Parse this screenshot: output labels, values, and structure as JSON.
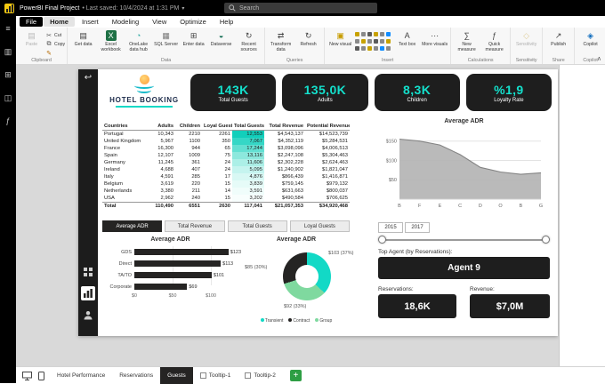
{
  "app": {
    "title": "PowerBI Final Project",
    "saved": "• Last saved: 10/4/2024 at 1:31 PM",
    "search_placeholder": "Search"
  },
  "menu": {
    "tabs": [
      "File",
      "Home",
      "Insert",
      "Modeling",
      "View",
      "Optimize",
      "Help"
    ],
    "active_index": 1
  },
  "ribbon": {
    "groups": [
      {
        "label": "Clipboard",
        "type": "clipboard",
        "items": [
          {
            "t": "Paste",
            "icon": "paste-icon",
            "disabled": true
          },
          {
            "t": "Cut",
            "icon": "cut-icon"
          },
          {
            "t": "Copy",
            "icon": "copy-icon"
          },
          {
            "t": "Format painter",
            "icon": "format-painter-icon"
          }
        ]
      },
      {
        "label": "Data",
        "items": [
          {
            "t": "Get data",
            "icon": "database-icon"
          },
          {
            "t": "Excel workbook",
            "icon": "excel-icon"
          },
          {
            "t": "OneLake data hub",
            "icon": "onelake-icon"
          },
          {
            "t": "SQL Server",
            "icon": "sql-server-icon"
          },
          {
            "t": "Enter data",
            "icon": "enter-data-icon"
          },
          {
            "t": "Dataverse",
            "icon": "dataverse-icon"
          },
          {
            "t": "Recent sources",
            "icon": "recent-sources-icon"
          }
        ]
      },
      {
        "label": "Queries",
        "items": [
          {
            "t": "Transform data",
            "icon": "transform-data-icon"
          },
          {
            "t": "Refresh",
            "icon": "refresh-icon"
          }
        ]
      },
      {
        "label": "Insert",
        "type": "insert",
        "items": [
          {
            "t": "New visual",
            "icon": "new-visual-icon"
          },
          {
            "t": "Text box",
            "icon": "text-box-icon"
          },
          {
            "t": "More visuals",
            "icon": "more-visuals-icon"
          }
        ]
      },
      {
        "label": "Calculations",
        "items": [
          {
            "t": "New measure",
            "icon": "new-measure-icon"
          },
          {
            "t": "Quick measure",
            "icon": "quick-measure-icon"
          }
        ]
      },
      {
        "label": "Sensitivity",
        "items": [
          {
            "t": "Sensitivity",
            "icon": "sensitivity-icon",
            "disabled": true
          }
        ]
      },
      {
        "label": "Share",
        "items": [
          {
            "t": "Publish",
            "icon": "publish-icon"
          }
        ]
      },
      {
        "label": "Copilot",
        "items": [
          {
            "t": "Copilot",
            "icon": "copilot-icon"
          }
        ]
      }
    ]
  },
  "rail": {
    "icons": [
      {
        "name": "menu-icon",
        "glyph": "≡"
      },
      {
        "name": "report-view-icon",
        "glyph": "▥"
      },
      {
        "name": "data-view-icon",
        "glyph": "⊞"
      },
      {
        "name": "model-view-icon",
        "glyph": "◫"
      },
      {
        "name": "dax-query-view-icon",
        "glyph": "ƒ"
      }
    ]
  },
  "logo": {
    "title": "HOTEL BOOKING"
  },
  "kpis": [
    {
      "value": "143K",
      "label": "Total Guests"
    },
    {
      "value": "135,0K",
      "label": "Adults"
    },
    {
      "value": "8,3K",
      "label": "Children"
    },
    {
      "value": "%1,9",
      "label": "Loyalty Rate"
    }
  ],
  "table": {
    "columns": [
      "Countries",
      "Adults",
      "Children",
      "Loyal Guests",
      "Total Guests",
      "Total Revenue",
      "Potential Revenue"
    ],
    "rows": [
      {
        "c": [
          "Portugal",
          "10,343",
          "2210",
          "2261",
          "12,553",
          "$4,543,137",
          "$14,523,739"
        ],
        "hl": "#12CFBB"
      },
      {
        "c": [
          "United Kingdom",
          "5,967",
          "1100",
          "350",
          "7,067",
          "$4,352,119",
          "$5,284,531"
        ],
        "hl": "#35D7C6"
      },
      {
        "c": [
          "France",
          "16,300",
          "944",
          "65",
          "17,244",
          "$3,098,096",
          "$4,006,513"
        ],
        "hl": "#63E0D2"
      },
      {
        "c": [
          "Spain",
          "12,107",
          "1009",
          "75",
          "13,116",
          "$2,247,108",
          "$5,304,463"
        ],
        "hl": "#8CE8DD"
      },
      {
        "c": [
          "Germany",
          "11,245",
          "361",
          "24",
          "11,606",
          "$2,302,228",
          "$2,624,463"
        ],
        "hl": "#ACEFE7"
      },
      {
        "c": [
          "Ireland",
          "4,688",
          "407",
          "24",
          "5,095",
          "$1,240,902",
          "$1,821,047"
        ],
        "hl": "#C5F4EF"
      },
      {
        "c": [
          "Italy",
          "4,591",
          "285",
          "17",
          "4,876",
          "$866,439",
          "$1,416,871"
        ],
        "hl": "#D8F8F4"
      },
      {
        "c": [
          "Belgium",
          "3,619",
          "220",
          "15",
          "3,839",
          "$759,145",
          "$979,132"
        ],
        "hl": "#E6FBF8"
      },
      {
        "c": [
          "Netherlands",
          "3,380",
          "211",
          "14",
          "3,591",
          "$631,663",
          "$800,037"
        ],
        "hl": "#F0FDFB"
      },
      {
        "c": [
          "USA",
          "2,962",
          "240",
          "15",
          "3,202",
          "$490,584",
          "$706,625"
        ],
        "hl": "#F8FEFD"
      }
    ],
    "total": [
      "Total",
      "110,490",
      "6551",
      "2630",
      "117,041",
      "$21,057,353",
      "$34,920,468"
    ]
  },
  "toggles": [
    {
      "label": "Average ADR",
      "active": true
    },
    {
      "label": "Total Revenue",
      "active": false
    },
    {
      "label": "Total Guests",
      "active": false
    },
    {
      "label": "Loyal Guests",
      "active": false
    }
  ],
  "charts": {
    "adr_trend": {
      "type": "area",
      "title": "Average ADR",
      "x": [
        "B",
        "F",
        "E",
        "C",
        "D",
        "O",
        "B",
        "G"
      ],
      "values": [
        155,
        150,
        140,
        115,
        82,
        70,
        64,
        68
      ],
      "ymax": 170,
      "yticks": [
        {
          "v": 150,
          "t": "$150"
        },
        {
          "v": 100,
          "t": "$100"
        },
        {
          "v": 50,
          "t": "$50"
        }
      ]
    },
    "adr_by_channel": {
      "type": "bar",
      "title": "Average ADR",
      "categories": [
        "GDS",
        "Direct",
        "TA/TO",
        "Corporate"
      ],
      "values": [
        123,
        113,
        101,
        69
      ],
      "labels": [
        "$123",
        "$113",
        "$101",
        "$69"
      ],
      "xticks": [
        {
          "v": 0,
          "t": "$0"
        },
        {
          "v": 50,
          "t": "$50"
        },
        {
          "v": 100,
          "t": "$100"
        }
      ]
    },
    "adr_by_segment": {
      "type": "donut",
      "title": "Average ADR",
      "segments": [
        {
          "name": "Transient",
          "pct": 37,
          "label": "$103 (37%)",
          "color": "#12D9C6"
        },
        {
          "name": "Contract",
          "pct": 30,
          "label": "$85 (30%)",
          "color": "#252423"
        },
        {
          "name": "Group",
          "pct": 33,
          "label": "$92 (33%)",
          "color": "#7FD99F"
        }
      ]
    }
  },
  "slider": {
    "start": "2015",
    "end": "2017"
  },
  "agent": {
    "label": "Top Agent (by Reservations):",
    "value": "Agent 9"
  },
  "stats": {
    "reservations_label": "Reservations:",
    "reservations_value": "18,6K",
    "revenue_label": "Revenue:",
    "revenue_value": "$7,0M"
  },
  "pages": {
    "tabs": [
      {
        "label": "Hotel Performance",
        "active": false,
        "icon": false
      },
      {
        "label": "Reservations",
        "active": false,
        "icon": false
      },
      {
        "label": "Guests",
        "active": true,
        "icon": false
      },
      {
        "label": "Tooltip-1",
        "active": false,
        "icon": true
      },
      {
        "label": "Tooltip-2",
        "active": false,
        "icon": true
      }
    ],
    "new_page_label": "+"
  },
  "colors": {
    "teal": "#14E0CC",
    "dark": "#252423",
    "plus_green": "#2E9E44"
  }
}
